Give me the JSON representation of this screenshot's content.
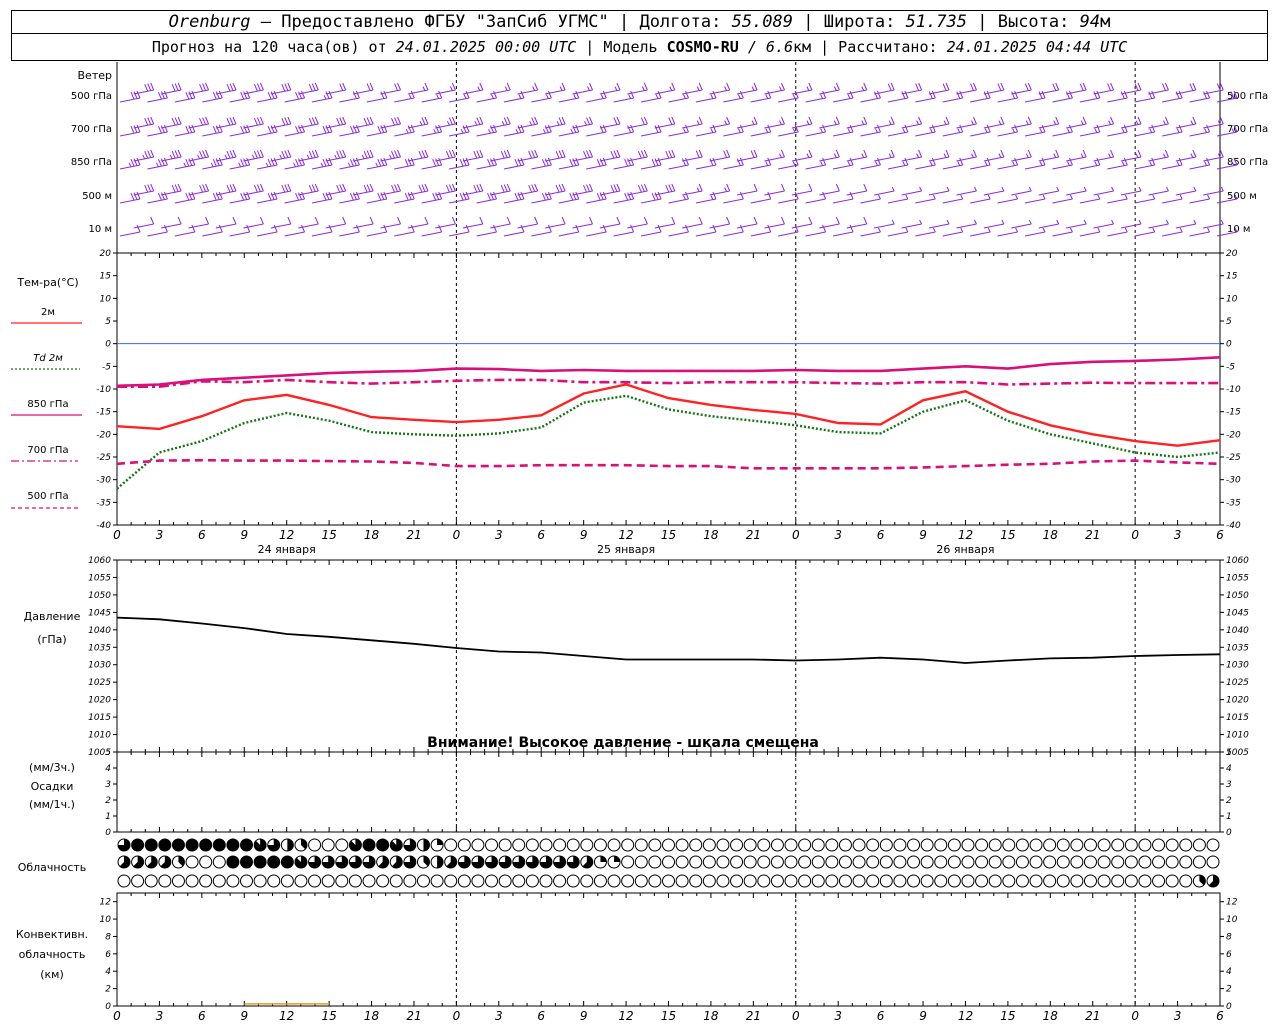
{
  "header": {
    "city": "Orenburg",
    "provider": " — Предоставлено ФГБУ \"ЗапСиб УГМС\" | Долгота: ",
    "lon": "55.089",
    "lat_label": " | Широта: ",
    "lat": "51.735",
    "alt_label": " | Высота: ",
    "alt": "94",
    "alt_unit": "м",
    "forecast_prefix": "Прогноз на 120 часа(ов) от ",
    "forecast_from": "24.01.2025 00:00 UTC",
    "model_label": "  | Модель ",
    "model": "COSMO-RU",
    "resolution": " / 6.6",
    "res_unit": "км",
    "calc_label": " | Рассчитано: ",
    "calc_time": "24.01.2025 04:44 UTC"
  },
  "wind_panel": {
    "title": "Ветер",
    "levels": [
      "500 гПа",
      "700 гПа",
      "850 гПа",
      "500 м",
      "10 м"
    ]
  },
  "temp_panel": {
    "title": "Тем-ра(°С)",
    "legend": [
      {
        "label": "2м",
        "color": "#ff2222",
        "dash": "solid"
      },
      {
        "label": "Td  2м",
        "color": "#117711",
        "dash": "dotted"
      },
      {
        "label": "850 гПа",
        "color": "#d9107c",
        "dash": "solid"
      },
      {
        "label": "700 гПа",
        "color": "#d9107c",
        "dash": "dashdot"
      },
      {
        "label": "500 гПа",
        "color": "#d9107c",
        "dash": "dashed"
      }
    ]
  },
  "pressure_panel": {
    "title": "Давление",
    "unit": "(гПа)",
    "warning": "Внимание! Высокое давление - шкала смещена"
  },
  "precip_panel": {
    "label_top": "(мм/3ч.)",
    "title": "Осадки",
    "label_bottom": "(мм/1ч.)"
  },
  "cloud_panel": {
    "title": "Облачность"
  },
  "conv_panel": {
    "title_1": "Конвективн.",
    "title_2": "облачность",
    "unit": "(км)"
  },
  "time_axis": {
    "hour_labels": [
      "0",
      "3",
      "6",
      "9",
      "12",
      "15",
      "18",
      "21",
      "0",
      "3",
      "6",
      "9",
      "12",
      "15",
      "18",
      "21",
      "0",
      "3",
      "6",
      "9",
      "12",
      "15",
      "18",
      "21",
      "0",
      "3",
      "6"
    ],
    "day_labels": [
      "24 января",
      "25 января",
      "26 января"
    ]
  },
  "chart_data": [
    {
      "type": "line",
      "title": "Тем-ра(°С)",
      "ylim": [
        -40,
        20
      ],
      "yticks": [
        -40,
        -35,
        -30,
        -25,
        -20,
        -15,
        -10,
        -5,
        0,
        5,
        10,
        15,
        20
      ],
      "x_hours": [
        0,
        3,
        6,
        9,
        12,
        15,
        18,
        21,
        24,
        27,
        30,
        33,
        36,
        39,
        42,
        45,
        48,
        51,
        54,
        57,
        60,
        63,
        66,
        69,
        72,
        75,
        78
      ],
      "series": [
        {
          "name": "2м",
          "color": "#ff2222",
          "values": [
            -18.2,
            -18.8,
            -16.0,
            -12.5,
            -11.3,
            -13.5,
            -16.2,
            -16.8,
            -17.3,
            -16.8,
            -15.8,
            -11.0,
            -9.0,
            -12.0,
            -13.5,
            -14.6,
            -15.5,
            -17.5,
            -17.8,
            -12.5,
            -10.5,
            -15.0,
            -18.0,
            -20.0,
            -21.5,
            -22.5,
            -21.3
          ]
        },
        {
          "name": "Td  2м",
          "color": "#117711",
          "values": [
            -32.0,
            -24.0,
            -21.5,
            -17.5,
            -15.3,
            -17.0,
            -19.5,
            -20.0,
            -20.3,
            -19.8,
            -18.5,
            -13.0,
            -11.5,
            -14.5,
            -16.0,
            -17.0,
            -18.0,
            -19.5,
            -19.8,
            -15.0,
            -12.5,
            -17.0,
            -20.0,
            -22.0,
            -24.0,
            -25.0,
            -24.0
          ]
        },
        {
          "name": "850 гПа",
          "color": "#d9107c",
          "values": [
            -9.3,
            -9.0,
            -8.0,
            -7.5,
            -7.0,
            -6.5,
            -6.2,
            -6.0,
            -5.5,
            -5.6,
            -6.0,
            -5.8,
            -6.0,
            -6.0,
            -6.0,
            -6.0,
            -5.8,
            -6.0,
            -6.0,
            -5.5,
            -5.0,
            -5.5,
            -4.5,
            -4.0,
            -3.8,
            -3.5,
            -3.0
          ]
        },
        {
          "name": "700 гПа",
          "color": "#d9107c",
          "values": [
            -9.5,
            -9.5,
            -8.3,
            -8.5,
            -8.0,
            -8.5,
            -8.8,
            -8.5,
            -8.2,
            -8.0,
            -8.0,
            -8.5,
            -8.5,
            -8.7,
            -8.5,
            -8.5,
            -8.5,
            -8.7,
            -8.8,
            -8.5,
            -8.5,
            -9.0,
            -8.8,
            -8.6,
            -8.7,
            -8.7,
            -8.7
          ]
        },
        {
          "name": "500 гПа",
          "color": "#d9107c",
          "values": [
            -26.5,
            -25.8,
            -25.7,
            -25.8,
            -25.8,
            -25.9,
            -26.0,
            -26.3,
            -27.0,
            -27.0,
            -26.8,
            -26.8,
            -26.8,
            -27.0,
            -27.0,
            -27.5,
            -27.5,
            -27.5,
            -27.5,
            -27.3,
            -27.0,
            -26.7,
            -26.5,
            -26.0,
            -25.8,
            -26.2,
            -26.5
          ]
        }
      ]
    },
    {
      "type": "line",
      "title": "Давление",
      "ylim": [
        1005,
        1060
      ],
      "yticks": [
        1005,
        1010,
        1015,
        1020,
        1025,
        1030,
        1035,
        1040,
        1045,
        1050,
        1055,
        1060
      ],
      "x_hours": [
        0,
        3,
        6,
        9,
        12,
        15,
        18,
        21,
        24,
        27,
        30,
        33,
        36,
        39,
        42,
        45,
        48,
        51,
        54,
        57,
        60,
        63,
        66,
        69,
        72,
        75,
        78
      ],
      "series": [
        {
          "name": "Давление",
          "color": "#000000",
          "values": [
            1043.5,
            1043.0,
            1041.8,
            1040.5,
            1038.8,
            1038.0,
            1037.0,
            1036.0,
            1034.8,
            1033.8,
            1033.5,
            1032.5,
            1031.5,
            1031.5,
            1031.5,
            1031.5,
            1031.2,
            1031.5,
            1032.0,
            1031.5,
            1030.5,
            1031.2,
            1031.8,
            1032.0,
            1032.5,
            1032.8,
            1033.0
          ]
        }
      ]
    },
    {
      "type": "bar",
      "title": "Осадки",
      "ylim": [
        0,
        5
      ],
      "yticks": [
        0,
        1,
        2,
        3,
        4,
        5
      ],
      "series": [
        {
          "name": "Осадки",
          "values": [
            0,
            0,
            0,
            0,
            0,
            0,
            0,
            0,
            0,
            0,
            0,
            0,
            0,
            0,
            0,
            0,
            0,
            0,
            0,
            0,
            0,
            0,
            0,
            0,
            0,
            0,
            0
          ]
        }
      ]
    },
    {
      "type": "bar",
      "title": "Конвективн. облачность",
      "ylim": [
        0,
        13
      ],
      "yticks": [
        0,
        2,
        4,
        6,
        8,
        10,
        12
      ],
      "series": [
        {
          "name": "Конвективн. облачность",
          "color": "#e8a020",
          "values": [
            0,
            0,
            0,
            0.25,
            0.25,
            0,
            0,
            0,
            0,
            0,
            0,
            0,
            0,
            0,
            0,
            0,
            0,
            0,
            0,
            0,
            0,
            0,
            0,
            0,
            0,
            0,
            0
          ]
        }
      ]
    }
  ],
  "cloud_cover": {
    "rows_eighths": [
      [
        6,
        8,
        8,
        8,
        8,
        8,
        8,
        8,
        8,
        8,
        7,
        6,
        4,
        3,
        0,
        0,
        0,
        7,
        8,
        8,
        7,
        6,
        4,
        2,
        0,
        0,
        0,
        0,
        0,
        0,
        0,
        0,
        0,
        0,
        0,
        0,
        0,
        0,
        0,
        0,
        0,
        0,
        0,
        0,
        0,
        0,
        0,
        0,
        0,
        0,
        0,
        0,
        0,
        0,
        0,
        0,
        0,
        0,
        0,
        0,
        0,
        0,
        0,
        0,
        0,
        0,
        0,
        0,
        0,
        0,
        0,
        0,
        0,
        0,
        0,
        0,
        0,
        0,
        0,
        0,
        0
      ],
      [
        5,
        5,
        5,
        5,
        3,
        0,
        0,
        0,
        8,
        8,
        8,
        8,
        8,
        7,
        6,
        6,
        6,
        6,
        6,
        5,
        5,
        6,
        3,
        4,
        5,
        6,
        6,
        6,
        6,
        6,
        6,
        6,
        6,
        6,
        5,
        2,
        2,
        0,
        0,
        0,
        0,
        0,
        0,
        0,
        0,
        0,
        0,
        0,
        0,
        0,
        0,
        0,
        0,
        0,
        0,
        0,
        0,
        0,
        0,
        0,
        0,
        0,
        0,
        0,
        0,
        0,
        0,
        0,
        0,
        0,
        0,
        0,
        0,
        0,
        0,
        0,
        0,
        0,
        0,
        0,
        0
      ],
      [
        0,
        0,
        0,
        0,
        0,
        0,
        0,
        0,
        0,
        0,
        0,
        0,
        0,
        0,
        0,
        0,
        0,
        0,
        0,
        0,
        0,
        0,
        0,
        0,
        0,
        0,
        0,
        0,
        0,
        0,
        0,
        0,
        0,
        0,
        0,
        0,
        0,
        0,
        0,
        0,
        0,
        0,
        0,
        0,
        0,
        0,
        0,
        0,
        0,
        0,
        0,
        0,
        0,
        0,
        0,
        0,
        0,
        0,
        0,
        0,
        0,
        0,
        0,
        0,
        0,
        0,
        0,
        0,
        0,
        0,
        0,
        0,
        0,
        0,
        0,
        0,
        0,
        0,
        0,
        3,
        5
      ]
    ]
  },
  "wind_barbs": {
    "levels": [
      "500 гПа",
      "700 гПа",
      "850 гПа",
      "500 м",
      "10 м"
    ],
    "knots": [
      [
        30,
        30,
        30,
        30,
        30,
        30,
        30,
        30,
        30,
        30,
        30,
        30,
        30,
        30,
        25,
        20,
        20,
        20,
        20,
        20,
        15,
        15,
        15,
        15,
        15,
        15,
        15,
        15,
        15,
        15,
        15,
        15,
        15,
        15,
        15,
        15,
        15,
        15,
        15,
        15,
        15,
        15,
        15,
        15,
        15,
        15,
        15,
        15,
        15,
        15,
        15,
        15,
        15,
        15,
        20,
        20,
        20,
        20,
        20,
        20,
        20,
        20,
        20,
        20,
        20,
        20,
        20,
        20,
        20,
        20,
        20,
        20,
        20,
        20,
        20,
        20,
        20,
        20,
        20,
        20,
        20
      ],
      [
        30,
        30,
        30,
        30,
        30,
        30,
        30,
        30,
        30,
        30,
        30,
        30,
        30,
        30,
        30,
        30,
        30,
        30,
        30,
        30,
        25,
        25,
        25,
        25,
        25,
        25,
        25,
        25,
        25,
        25,
        25,
        25,
        25,
        25,
        20,
        20,
        20,
        20,
        20,
        20,
        15,
        15,
        15,
        15,
        15,
        15,
        15,
        15,
        15,
        15,
        15,
        15,
        15,
        15,
        15,
        15,
        15,
        15,
        15,
        15,
        15,
        15,
        15,
        15,
        15,
        15,
        15,
        15,
        15,
        15,
        15,
        15,
        15,
        15,
        15,
        15,
        15,
        15,
        15,
        15,
        15
      ],
      [
        35,
        35,
        35,
        35,
        35,
        35,
        35,
        35,
        35,
        35,
        35,
        35,
        35,
        35,
        35,
        35,
        35,
        35,
        35,
        35,
        30,
        30,
        30,
        30,
        30,
        30,
        30,
        30,
        30,
        30,
        30,
        30,
        30,
        30,
        30,
        30,
        30,
        30,
        30,
        30,
        20,
        20,
        20,
        20,
        20,
        20,
        15,
        15,
        15,
        15,
        15,
        15,
        15,
        15,
        15,
        15,
        15,
        15,
        15,
        15,
        15,
        15,
        15,
        15,
        15,
        15,
        15,
        15,
        15,
        15,
        15,
        15,
        15,
        15,
        15,
        15,
        15,
        15,
        15,
        15,
        15
      ],
      [
        30,
        30,
        30,
        30,
        30,
        30,
        30,
        30,
        30,
        30,
        30,
        30,
        30,
        30,
        30,
        30,
        30,
        30,
        30,
        30,
        30,
        30,
        30,
        30,
        30,
        30,
        30,
        30,
        30,
        30,
        30,
        30,
        30,
        30,
        30,
        30,
        30,
        30,
        30,
        30,
        15,
        15,
        15,
        15,
        10,
        10,
        10,
        10,
        10,
        10,
        10,
        10,
        10,
        10,
        5,
        5,
        5,
        5,
        5,
        5,
        5,
        5,
        5,
        5,
        5,
        5,
        5,
        5,
        5,
        5,
        5,
        5,
        5,
        5,
        5,
        5,
        5,
        5,
        5,
        5,
        5
      ],
      [
        10,
        10,
        10,
        10,
        10,
        10,
        10,
        10,
        10,
        10,
        10,
        10,
        10,
        10,
        10,
        10,
        10,
        10,
        10,
        10,
        10,
        10,
        10,
        10,
        10,
        10,
        10,
        10,
        10,
        10,
        10,
        10,
        10,
        10,
        10,
        10,
        10,
        10,
        10,
        10,
        10,
        10,
        10,
        10,
        10,
        10,
        10,
        10,
        10,
        10,
        10,
        10,
        10,
        10,
        5,
        5,
        5,
        5,
        5,
        5,
        5,
        5,
        5,
        5,
        5,
        5,
        5,
        5,
        5,
        5,
        5,
        5,
        5,
        5,
        5,
        5,
        5,
        5,
        5,
        5,
        5
      ]
    ]
  },
  "colors": {
    "wind": "#8a2be2",
    "zero_line": "#4060ff",
    "grid": "#000000",
    "conv_bar": "#e8a020"
  }
}
